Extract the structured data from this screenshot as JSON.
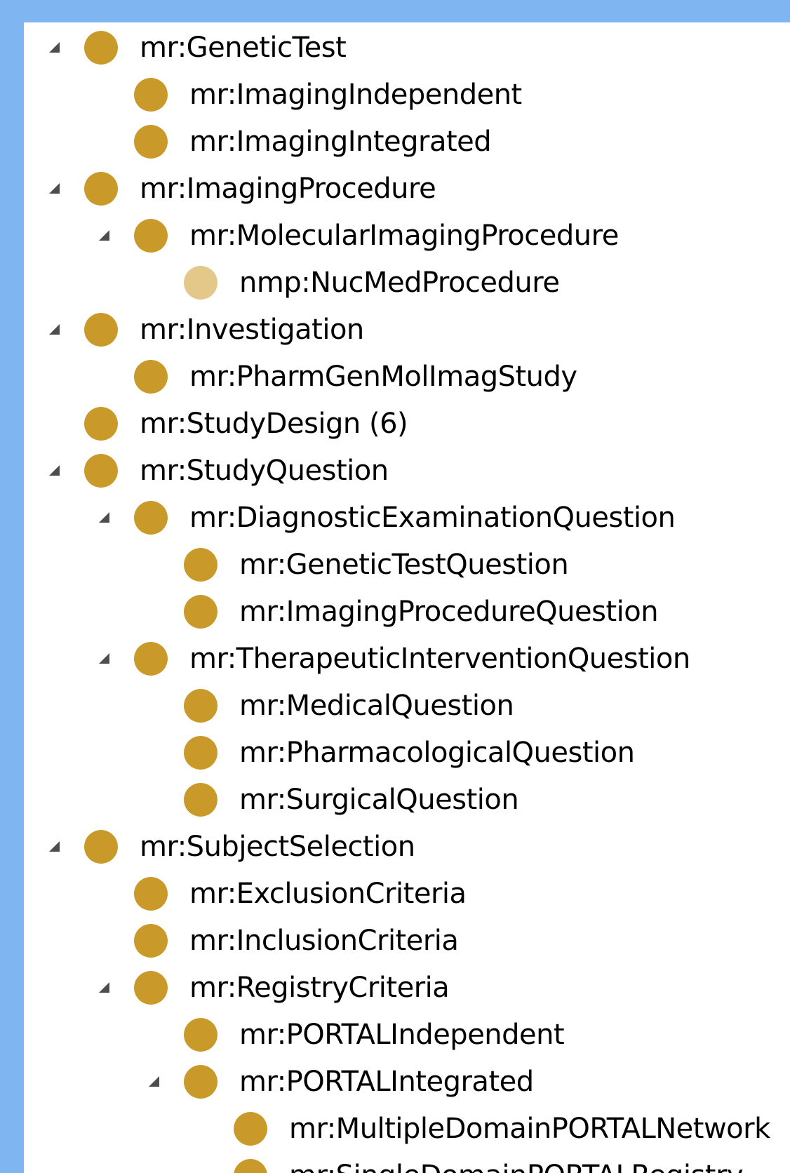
{
  "colors": {
    "background": "#7fb6f2",
    "panel": "#ffffff",
    "class_dot": "#c99a2a",
    "class_dot_inferred": "#e3c88a",
    "expander": "#4d4d4d"
  },
  "tree": {
    "rows": [
      {
        "label": "mr:GeneticTest",
        "depth": 0,
        "expanded": true,
        "icon": "class-icon"
      },
      {
        "label": "mr:ImagingIndependent",
        "depth": 1,
        "expanded": false,
        "icon": "class-icon"
      },
      {
        "label": "mr:ImagingIntegrated",
        "depth": 1,
        "expanded": false,
        "icon": "class-icon"
      },
      {
        "label": "mr:ImagingProcedure",
        "depth": 0,
        "expanded": true,
        "icon": "class-icon"
      },
      {
        "label": "mr:MolecularImagingProcedure",
        "depth": 1,
        "expanded": true,
        "icon": "class-icon"
      },
      {
        "label": "nmp:NucMedProcedure",
        "depth": 2,
        "expanded": false,
        "icon": "class-icon",
        "faded": true
      },
      {
        "label": "mr:Investigation",
        "depth": 0,
        "expanded": true,
        "icon": "class-icon"
      },
      {
        "label": "mr:PharmGenMolImagStudy",
        "depth": 1,
        "expanded": false,
        "icon": "class-icon"
      },
      {
        "label": "mr:StudyDesign  (6)",
        "depth": 0,
        "expanded": false,
        "icon": "class-icon"
      },
      {
        "label": "mr:StudyQuestion",
        "depth": 0,
        "expanded": true,
        "icon": "class-icon"
      },
      {
        "label": "mr:DiagnosticExaminationQuestion",
        "depth": 1,
        "expanded": true,
        "icon": "class-icon"
      },
      {
        "label": "mr:GeneticTestQuestion",
        "depth": 2,
        "expanded": false,
        "icon": "class-icon"
      },
      {
        "label": "mr:ImagingProcedureQuestion",
        "depth": 2,
        "expanded": false,
        "icon": "class-icon"
      },
      {
        "label": "mr:TherapeuticInterventionQuestion",
        "depth": 1,
        "expanded": true,
        "icon": "class-icon"
      },
      {
        "label": "mr:MedicalQuestion",
        "depth": 2,
        "expanded": false,
        "icon": "class-icon"
      },
      {
        "label": "mr:PharmacologicalQuestion",
        "depth": 2,
        "expanded": false,
        "icon": "class-icon"
      },
      {
        "label": "mr:SurgicalQuestion",
        "depth": 2,
        "expanded": false,
        "icon": "class-icon"
      },
      {
        "label": "mr:SubjectSelection",
        "depth": 0,
        "expanded": true,
        "icon": "class-icon"
      },
      {
        "label": "mr:ExclusionCriteria",
        "depth": 1,
        "expanded": false,
        "icon": "class-icon"
      },
      {
        "label": "mr:InclusionCriteria",
        "depth": 1,
        "expanded": false,
        "icon": "class-icon"
      },
      {
        "label": "mr:RegistryCriteria",
        "depth": 1,
        "expanded": true,
        "icon": "class-icon"
      },
      {
        "label": "mr:PORTALIndependent",
        "depth": 2,
        "expanded": false,
        "icon": "class-icon"
      },
      {
        "label": "mr:PORTALIntegrated",
        "depth": 2,
        "expanded": true,
        "icon": "class-icon"
      },
      {
        "label": "mr:MultipleDomainPORTALNetwork",
        "depth": 3,
        "expanded": false,
        "icon": "class-icon"
      },
      {
        "label": "mr:SingleDomainPORTALRegistry",
        "depth": 3,
        "expanded": false,
        "icon": "class-icon"
      }
    ]
  }
}
